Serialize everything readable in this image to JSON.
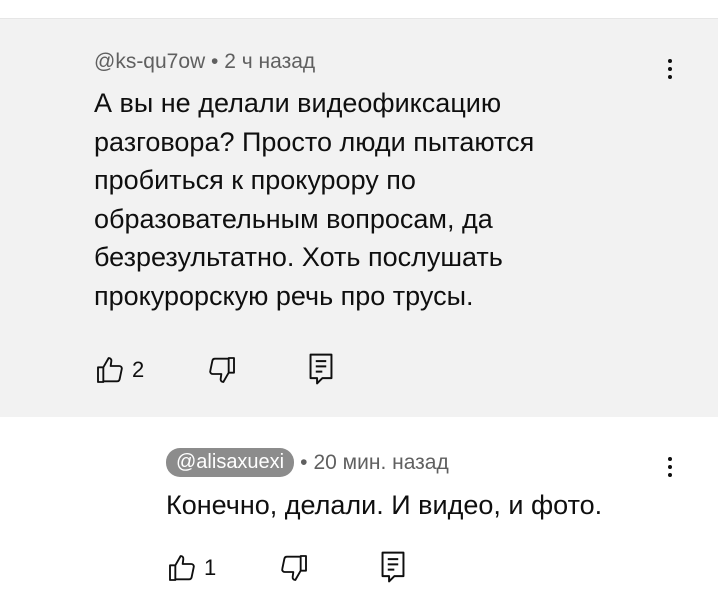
{
  "comment": {
    "author": "@ks-qu7ow",
    "time": "2 ч назад",
    "separator": "•",
    "text_lines": [
      "А вы не делали видеофиксацию",
      "разговора? Просто люди пытаются",
      "пробиться к прокурору по",
      "образовательным вопросам, да",
      "безрезультатно. Хоть послушать",
      "прокурорскую речь про трусы."
    ],
    "like_count": "2"
  },
  "reply": {
    "author": "@alisaxuexi",
    "time": "20 мин. назад",
    "separator": "•",
    "text": "Конечно, делали. И видео, и фото.",
    "like_count": "1"
  },
  "colors": {
    "highlight_bg": "#f2f2f2",
    "meta_text": "#606060",
    "body_text": "#0f0f0f",
    "handle_pill_bg": "#8c8c8c"
  },
  "icons": [
    "like-icon",
    "dislike-icon",
    "reply-icon",
    "more-vert-icon"
  ]
}
